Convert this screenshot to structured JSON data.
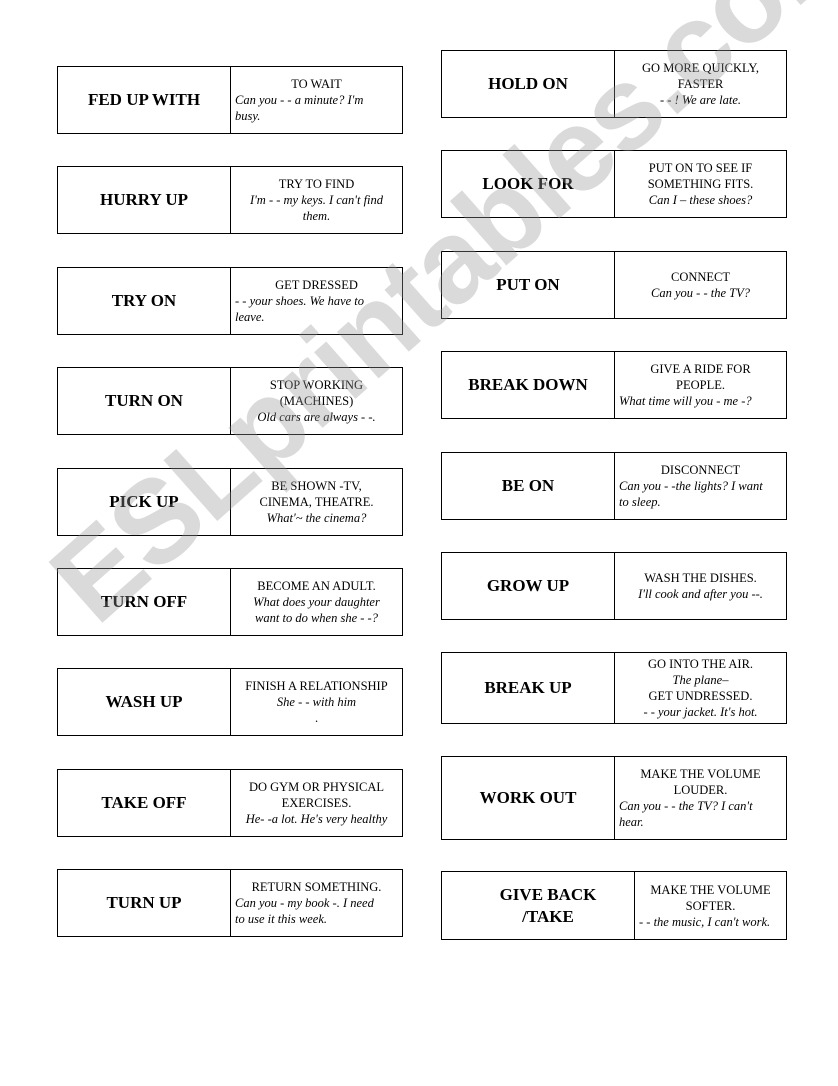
{
  "watermark": "ESLprintables.com",
  "left_cards": [
    {
      "term": "FED UP WITH",
      "lines": [
        {
          "t": "TO WAIT",
          "i": false,
          "a": "c"
        },
        {
          "t": "Can you - - a minute? I'm",
          "i": true,
          "a": "l"
        },
        {
          "t": "busy.",
          "i": true,
          "a": "l"
        }
      ]
    },
    {
      "term": "HURRY UP",
      "lines": [
        {
          "t": "TRY TO FIND",
          "i": false,
          "a": "c"
        },
        {
          "t": "I'm - - my keys. I can't find",
          "i": true,
          "a": "c"
        },
        {
          "t": "them.",
          "i": true,
          "a": "c"
        }
      ]
    },
    {
      "term": "TRY ON",
      "lines": [
        {
          "t": "GET DRESSED",
          "i": false,
          "a": "c"
        },
        {
          "t": "- - your shoes.  We have to",
          "i": true,
          "a": "l"
        },
        {
          "t": "leave.",
          "i": true,
          "a": "l"
        }
      ]
    },
    {
      "term": "TURN ON",
      "lines": [
        {
          "t": "STOP WORKING",
          "i": false,
          "a": "c"
        },
        {
          "t": "(MACHINES)",
          "i": false,
          "a": "c"
        },
        {
          "t": "Old cars are always - -.",
          "i": true,
          "a": "c"
        }
      ]
    },
    {
      "term": "PICK UP",
      "lines": [
        {
          "t": "BE SHOWN -TV,",
          "i": false,
          "a": "c"
        },
        {
          "t": "CINEMA, THEATRE.",
          "i": false,
          "a": "c"
        },
        {
          "t": "What'~ the cinema?",
          "i": true,
          "a": "c"
        }
      ]
    },
    {
      "term": "TURN OFF",
      "lines": [
        {
          "t": "BECOME AN ADULT.",
          "i": false,
          "a": "c"
        },
        {
          "t": "What does your daughter",
          "i": true,
          "a": "c"
        },
        {
          "t": "want to do when she - -?",
          "i": true,
          "a": "c"
        }
      ]
    },
    {
      "term": "WASH UP",
      "lines": [
        {
          "t": "FINISH A RELATIONSHIP",
          "i": false,
          "a": "c"
        },
        {
          "t": "She - - with him",
          "i": true,
          "a": "c"
        },
        {
          "t": ".",
          "i": false,
          "a": "c"
        }
      ]
    },
    {
      "term": "TAKE OFF",
      "lines": [
        {
          "t": "DO GYM OR PHYSICAL",
          "i": false,
          "a": "c"
        },
        {
          "t": "EXERCISES.",
          "i": false,
          "a": "c"
        },
        {
          "t": "He- -a lot.  He's very healthy",
          "i": true,
          "a": "c"
        }
      ]
    },
    {
      "term": "TURN UP",
      "lines": [
        {
          "t": "RETURN SOMETHING.",
          "i": false,
          "a": "c"
        },
        {
          "t": "Can you - my book -. I need",
          "i": true,
          "a": "l"
        },
        {
          "t": "to use it this week.",
          "i": true,
          "a": "l"
        }
      ]
    }
  ],
  "right_cards": [
    {
      "term": "HOLD ON",
      "lines": [
        {
          "t": "GO MORE QUICKLY,",
          "i": false,
          "a": "c"
        },
        {
          "t": "FASTER",
          "i": false,
          "a": "c"
        },
        {
          "t": "- - ! We are late.",
          "i": true,
          "a": "c"
        }
      ]
    },
    {
      "term": "LOOK FOR",
      "lines": [
        {
          "t": "PUT ON TO SEE IF",
          "i": false,
          "a": "c"
        },
        {
          "t": "SOMETHING FITS.",
          "i": false,
          "a": "c"
        },
        {
          "t": "Can I – these shoes?",
          "i": true,
          "a": "c"
        }
      ]
    },
    {
      "term": "PUT ON",
      "lines": [
        {
          "t": "CONNECT",
          "i": false,
          "a": "c"
        },
        {
          "t": "Can you - - the TV?",
          "i": true,
          "a": "c"
        }
      ]
    },
    {
      "term": "BREAK DOWN",
      "lines": [
        {
          "t": "GIVE A RIDE FOR",
          "i": false,
          "a": "c"
        },
        {
          "t": "PEOPLE.",
          "i": false,
          "a": "c"
        },
        {
          "t": "What time will you -  me -?",
          "i": true,
          "a": "l"
        }
      ]
    },
    {
      "term": "BE ON",
      "lines": [
        {
          "t": "DISCONNECT",
          "i": false,
          "a": "c"
        },
        {
          "t": "Can you - -the lights? I want",
          "i": true,
          "a": "l"
        },
        {
          "t": "to sleep.",
          "i": true,
          "a": "l"
        }
      ]
    },
    {
      "term": "GROW UP",
      "lines": [
        {
          "t": "WASH THE DISHES.",
          "i": false,
          "a": "c"
        },
        {
          "t": "I'll cook and after you --.",
          "i": true,
          "a": "c"
        }
      ]
    },
    {
      "term": "BREAK UP",
      "lines": [
        {
          "t": "GO INTO THE AIR.",
          "i": false,
          "a": "c"
        },
        {
          "t": "The plane–",
          "i": true,
          "a": "c"
        },
        {
          "t": "GET UNDRESSED.",
          "i": false,
          "a": "c"
        },
        {
          "t": "- - your jacket. It's hot.",
          "i": true,
          "a": "c"
        }
      ]
    },
    {
      "term": "WORK OUT",
      "lines": [
        {
          "t": "MAKE THE VOLUME",
          "i": false,
          "a": "c"
        },
        {
          "t": "LOUDER.",
          "i": false,
          "a": "c"
        },
        {
          "t": "Can you - - the TV? I can't",
          "i": true,
          "a": "l"
        },
        {
          "t": "hear.",
          "i": true,
          "a": "l"
        }
      ]
    },
    {
      "term": "GIVE BACK\n/TAKE",
      "lines": [
        {
          "t": "MAKE THE VOLUME",
          "i": false,
          "a": "c"
        },
        {
          "t": "SOFTER.",
          "i": false,
          "a": "c"
        },
        {
          "t": "- - the music, I can't work.",
          "i": true,
          "a": "l"
        }
      ]
    }
  ]
}
